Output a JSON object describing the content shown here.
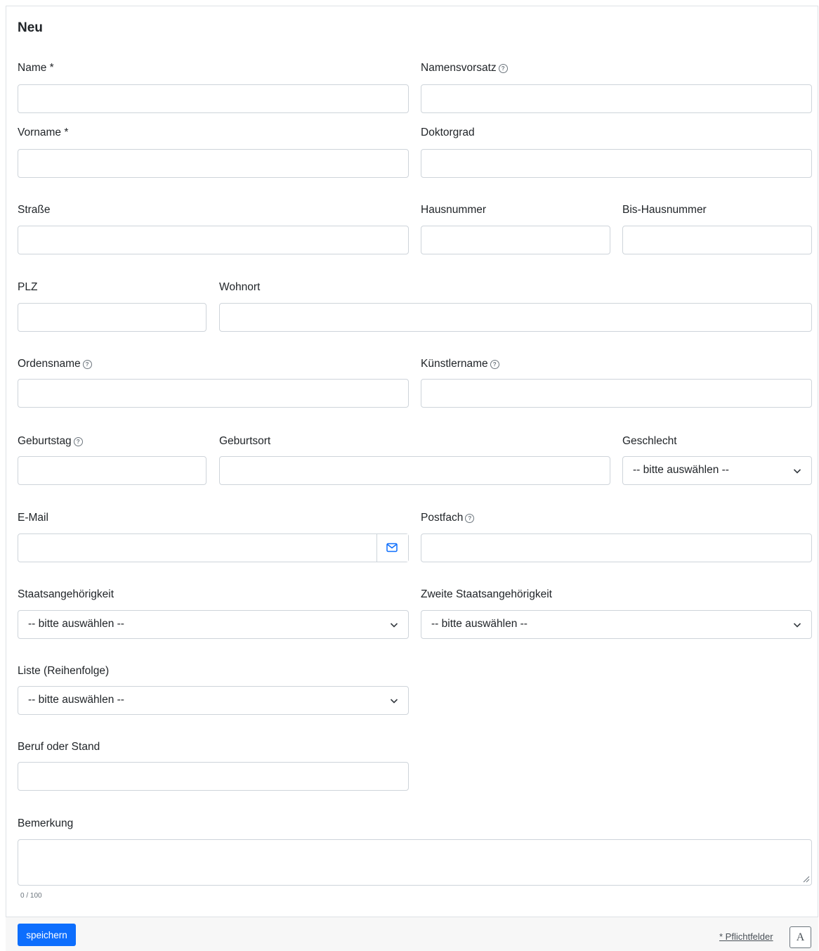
{
  "form": {
    "title": "Neu",
    "fields": {
      "name": {
        "label": "Name *",
        "value": ""
      },
      "namensvorsatz": {
        "label": "Namensvorsatz",
        "value": ""
      },
      "vorname": {
        "label": "Vorname *",
        "value": ""
      },
      "doktorgrad": {
        "label": "Doktorgrad",
        "value": ""
      },
      "strasse": {
        "label": "Straße",
        "value": ""
      },
      "hausnummer": {
        "label": "Hausnummer",
        "value": ""
      },
      "bis_hausnummer": {
        "label": "Bis-Hausnummer",
        "value": ""
      },
      "plz": {
        "label": "PLZ",
        "value": ""
      },
      "wohnort": {
        "label": "Wohnort",
        "value": ""
      },
      "ordensname": {
        "label": "Ordensname",
        "value": ""
      },
      "kuenstlername": {
        "label": "Künstlername",
        "value": ""
      },
      "geburtstag": {
        "label": "Geburtstag",
        "value": ""
      },
      "geburtsort": {
        "label": "Geburtsort",
        "value": ""
      },
      "geschlecht": {
        "label": "Geschlecht",
        "selected": "-- bitte auswählen --"
      },
      "email": {
        "label": "E-Mail",
        "value": ""
      },
      "postfach": {
        "label": "Postfach",
        "value": ""
      },
      "staatsangehoerigkeit": {
        "label": "Staatsangehörigkeit",
        "selected": "-- bitte auswählen --"
      },
      "zweite_staatsangehoerigkeit": {
        "label": "Zweite Staatsangehörigkeit",
        "selected": "-- bitte auswählen --"
      },
      "liste": {
        "label": "Liste (Reihenfolge)",
        "selected": "-- bitte auswählen --"
      },
      "beruf": {
        "label": "Beruf oder Stand",
        "value": ""
      },
      "bemerkung": {
        "label": "Bemerkung",
        "value": "",
        "counter": "0 / 100"
      }
    },
    "help_icon": "question-circle-icon",
    "email_icon": "envelope-icon"
  },
  "footer": {
    "save_label": "speichern",
    "required_note": "* Pflichtfelder",
    "font_toggle_label": "A"
  },
  "colors": {
    "primary": "#0d6efd",
    "border": "#ced4da",
    "text": "#212529",
    "muted": "#6c757d",
    "footer_bg": "#f7f7f7"
  }
}
